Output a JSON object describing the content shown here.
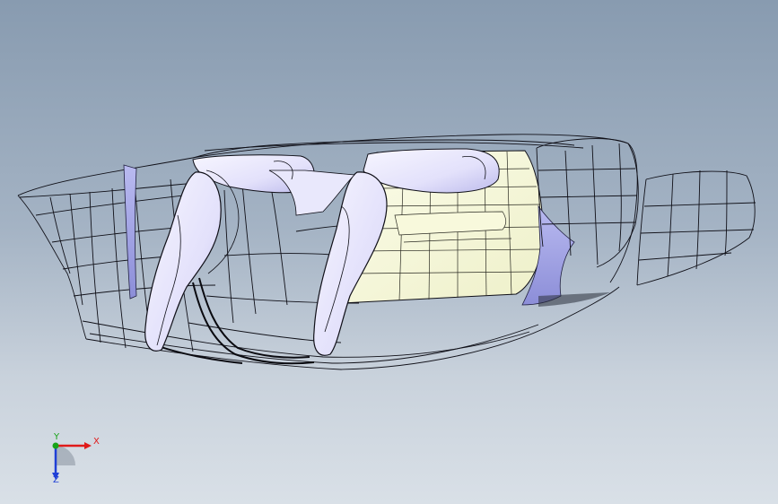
{
  "viewport": {
    "background_top": "#889bb0",
    "background_bottom": "#d9e0e7"
  },
  "model": {
    "wire_color": "#0c0c12",
    "seat_fill": "#ebe9ff",
    "seat_shadow": "#b3b1e6",
    "floor_fill": "#f4f6d8",
    "floor_highlight": "#fafbe8",
    "mirror_fill": "#a5a6e6"
  },
  "triad": {
    "x_label": "X",
    "y_label": "Y",
    "z_label": "Z",
    "x_color": "#e01a1a",
    "y_color": "#17a317",
    "z_color": "#1f3fd6"
  }
}
